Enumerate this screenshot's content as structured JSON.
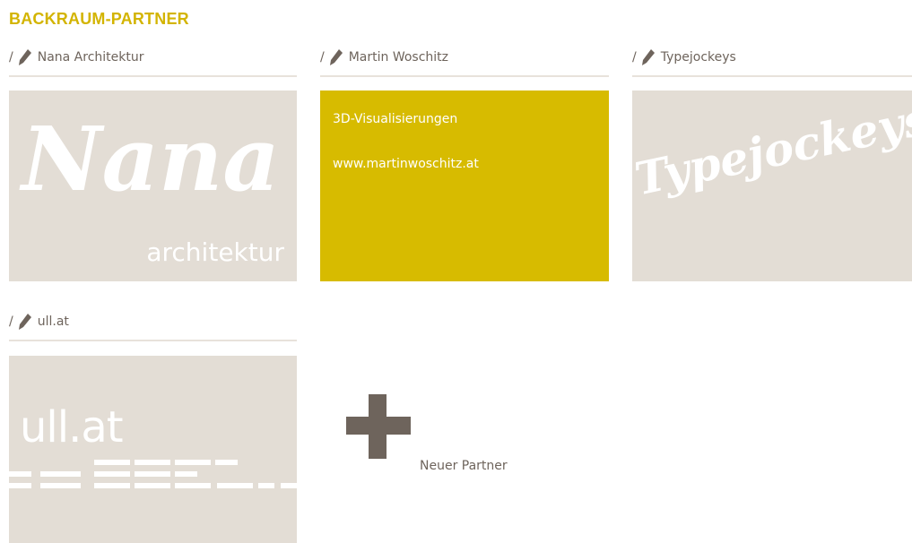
{
  "page": {
    "title": "BACKRAUM-PARTNER"
  },
  "partners": [
    {
      "name": "Nana Architektur",
      "logo": {
        "script": "Nana",
        "sub": "architektur"
      }
    },
    {
      "name": "Martin Woschitz",
      "description": "3D-Visualisierungen",
      "url": "www.martinwoschitz.at",
      "color": "#d7bb00"
    },
    {
      "name": "Typejockeys",
      "logo": {
        "script": "Typejockeys"
      }
    },
    {
      "name": "ull.at",
      "logo": {
        "text": "ull.at"
      }
    }
  ],
  "new_partner": {
    "label": "Neuer Partner"
  },
  "icons": {
    "edit": "pencil-icon",
    "add": "plus-icon"
  },
  "colors": {
    "accent": "#d3b400",
    "tile": "#e3ddd5",
    "text": "#6e645c",
    "highlight": "#d7bb00"
  }
}
